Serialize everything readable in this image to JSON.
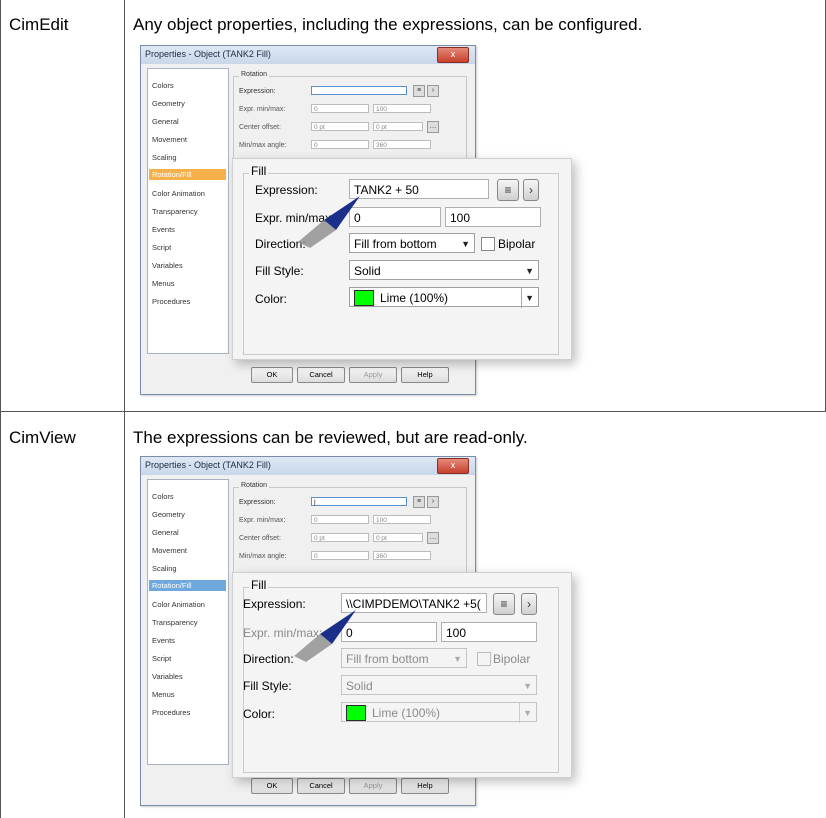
{
  "rows": [
    {
      "label": "CimEdit",
      "description": "Any object properties, including the expressions, can be configured."
    },
    {
      "label": "CimView",
      "description": "The expressions can be reviewed, but are read-only."
    }
  ],
  "dialog": {
    "title": "Properties - Object (TANK2 Fill)",
    "close_glyph": "x",
    "nav_items": [
      "Colors",
      "Geometry",
      "General",
      "Movement",
      "Scaling",
      "Rotation/Fill",
      "Color Animation",
      "Transparency",
      "Events",
      "Script",
      "Variables",
      "Menus",
      "Procedures"
    ],
    "selected_nav": "Rotation/Fill",
    "rotation": {
      "group_label": "Rotation",
      "expression_label": "Expression:",
      "minmax_label": "Expr. min/max:",
      "min_value": "0",
      "max_value": "100",
      "center_label": "Center offset:",
      "center_x": "0 pt",
      "center_y": "0 pt",
      "angle_label": "Min/max angle:",
      "angle_min": "0",
      "angle_max": "360"
    },
    "buttons": {
      "ok": "OK",
      "cancel": "Cancel",
      "apply": "Apply",
      "help": "Help"
    }
  },
  "fill_edit": {
    "group_label": "Fill",
    "expression_label": "Expression:",
    "expression_value": "TANK2 + 50",
    "minmax_label": "Expr. min/max:",
    "min_value": "0",
    "max_value": "100",
    "direction_label": "Direction:",
    "direction_value": "Fill from bottom",
    "bipolar_label": "Bipolar",
    "style_label": "Fill Style:",
    "style_value": "Solid",
    "color_label": "Color:",
    "color_value": "Lime (100%)"
  },
  "fill_view": {
    "group_label": "Fill",
    "expression_label": "Expression:",
    "expression_value": "\\\\CIMPDEMO\\TANK2 +5(",
    "minmax_label": "Expr. min/max:",
    "min_value": "0",
    "max_value": "100",
    "direction_label": "Direction:",
    "direction_value": "Fill from bottom",
    "bipolar_label": "Bipolar",
    "style_label": "Fill Style:",
    "style_value": "Solid",
    "color_label": "Color:",
    "color_value": "Lime (100%)"
  },
  "colors": {
    "selected_edit": "#f6b04a",
    "selected_view": "#6ea8dc",
    "swatch": "#00ff00",
    "arrow": "#1a2f8a"
  },
  "icons": {
    "expression_browse": "database-icon",
    "expression_more": "chevron-right-icon",
    "dropdown": "chevron-down-icon"
  }
}
